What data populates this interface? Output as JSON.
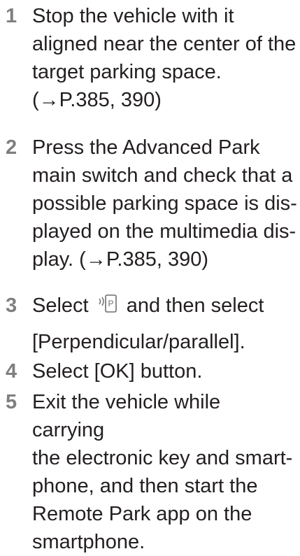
{
  "steps": [
    {
      "number": "1",
      "text": "Stop the vehicle with it\naligned near the center of the\ntarget parking space.\n(→P.385, 390)"
    },
    {
      "number": "2",
      "text": "Press the Advanced Park\nmain switch and check that a\npossible parking space is dis-\nplayed on the multimedia dis-\nplay. (→P.385, 390)"
    },
    {
      "number": "3",
      "text_before_icon": "Select",
      "icon": "remote-park-icon",
      "text_after_icon": "and then select",
      "text_line2": "[Perpendicular/parallel]."
    },
    {
      "number": "4",
      "text": "Select [OK] button."
    },
    {
      "number": "5",
      "text": "Exit the vehicle while carrying\nthe electronic key and smart-\nphone, and then start the\nRemote Park app on the\nsmartphone."
    }
  ]
}
